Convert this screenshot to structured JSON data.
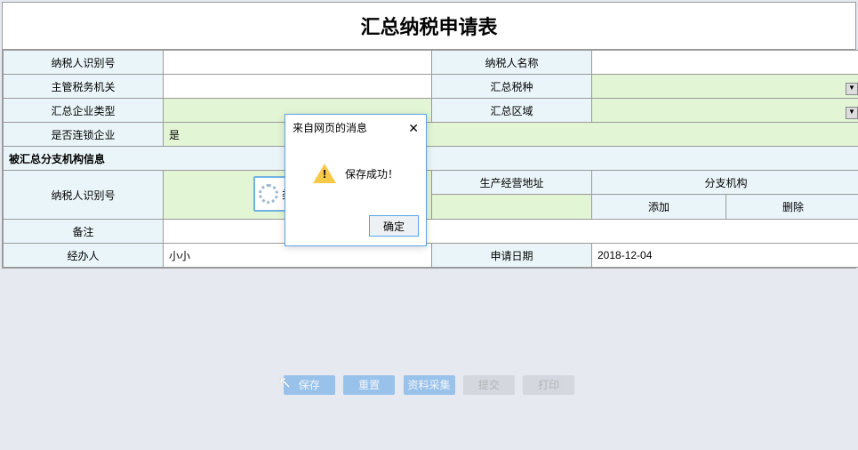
{
  "title": "汇总纳税申请表",
  "labels": {
    "taxpayer_id": "纳税人识别号",
    "taxpayer_name": "纳税人名称",
    "tax_authority": "主管税务机关",
    "tax_type": "汇总税种",
    "enterprise_type": "汇总企业类型",
    "region": "汇总区域",
    "is_chain": "是否连锁企业",
    "branch_section": "被汇总分支机构信息",
    "branch_taxpayer_id": "纳税人识别号",
    "business_addr": "生产经营地址",
    "branch_org": "分支机构",
    "remark": "备注",
    "operator": "经办人",
    "apply_date": "申请日期"
  },
  "values": {
    "taxpayer_id": "",
    "taxpayer_name": "",
    "tax_authority": "",
    "tax_type": "",
    "enterprise_type": "",
    "region": "",
    "is_chain": "是",
    "branch_taxpayer_id": "",
    "business_addr": "",
    "remark": "",
    "operator": "小小",
    "apply_date": "2018-12-04"
  },
  "branch_buttons": {
    "add": "添加",
    "delete": "删除"
  },
  "toolbar": {
    "save": "保存",
    "reset": "重置",
    "collect": "资料采集",
    "submit": "提交",
    "print": "打印"
  },
  "spinner_text": "类",
  "dialog": {
    "title": "来自网页的消息",
    "message": "保存成功！",
    "ok": "确定"
  }
}
